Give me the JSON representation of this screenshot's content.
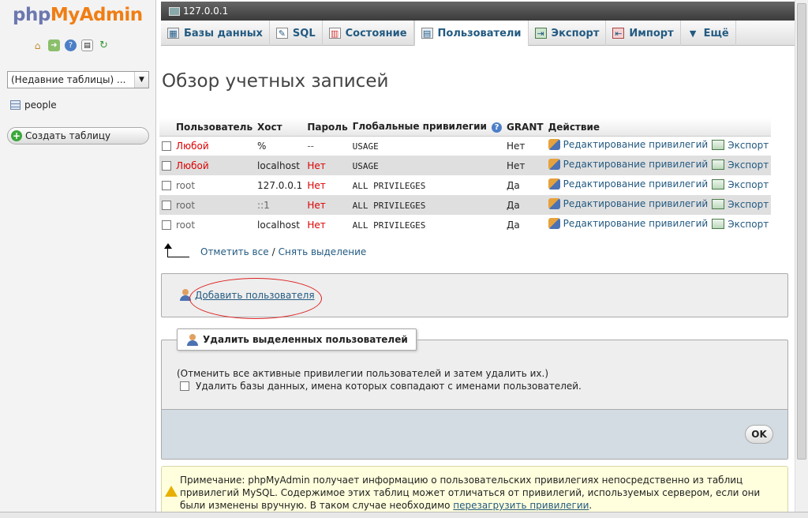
{
  "nav": {
    "logo_php": "php",
    "logo_rest": "MyAdmin",
    "icons": [
      "home-icon",
      "exit-icon",
      "help-icon",
      "docs-icon",
      "reload-icon"
    ],
    "recent_tables": "(Недавние таблицы) ...",
    "databases": [
      {
        "name": "people"
      }
    ],
    "create_table": "Создать таблицу"
  },
  "server": {
    "host": "127.0.0.1"
  },
  "tabs": [
    {
      "label": "Базы данных",
      "icon": "database-icon"
    },
    {
      "label": "SQL",
      "icon": "sql-icon"
    },
    {
      "label": "Состояние",
      "icon": "status-icon"
    },
    {
      "label": "Пользователи",
      "icon": "users-icon",
      "active": true
    },
    {
      "label": "Экспорт",
      "icon": "export-icon"
    },
    {
      "label": "Импорт",
      "icon": "import-icon"
    },
    {
      "label": "Ещё",
      "icon": "chevron-down-icon"
    }
  ],
  "page_title": "Обзор учетных записей",
  "table": {
    "headers": [
      "Пользователь",
      "Хост",
      "Пароль",
      "Глобальные привилегии",
      "GRANT",
      "Действие"
    ],
    "rows": [
      {
        "user": "Любой",
        "host": "%",
        "password": "--",
        "privs": "USAGE",
        "grant": "Нет"
      },
      {
        "user": "Любой",
        "host": "localhost",
        "password": "Нет",
        "privs": "USAGE",
        "grant": "Нет"
      },
      {
        "user": "root",
        "host": "127.0.0.1",
        "password": "Нет",
        "privs": "ALL PRIVILEGES",
        "grant": "Да"
      },
      {
        "user": "root",
        "host": "::1",
        "password": "Нет",
        "privs": "ALL PRIVILEGES",
        "grant": "Да"
      },
      {
        "user": "root",
        "host": "localhost",
        "password": "Нет",
        "privs": "ALL PRIVILEGES",
        "grant": "Да"
      }
    ],
    "edit_label": "Редактирование привилегий",
    "export_label": "Экспорт"
  },
  "check_all": "Отметить все",
  "separator": "/",
  "uncheck_all": "Снять выделение",
  "add_user": "Добавить пользователя",
  "delete_section": {
    "legend": "Удалить выделенных пользователей",
    "revoke_text": "(Отменить все активные привилегии пользователей и затем удалить их.)",
    "drop_db_label": "Удалить базы данных, имена которых совпадают с именами пользователей.",
    "ok": "OK"
  },
  "notice": {
    "text_before": "Примечание: phpMyAdmin получает информацию о пользовательских привилегиях непосредственно из таблиц привилегий MySQL. Содержимое этих таблиц может отличаться от привилегий, используемых сервером, если они были изменены вручную. В таком случае необходимо ",
    "link": "перезагрузить привилегии",
    "text_after": "."
  },
  "colors": {
    "link": "#235a81",
    "red_user": "#dd0000",
    "logo_php": "#6c78af",
    "logo_myadmin": "#f07e14",
    "annotation_ellipse": "#dd2222"
  }
}
